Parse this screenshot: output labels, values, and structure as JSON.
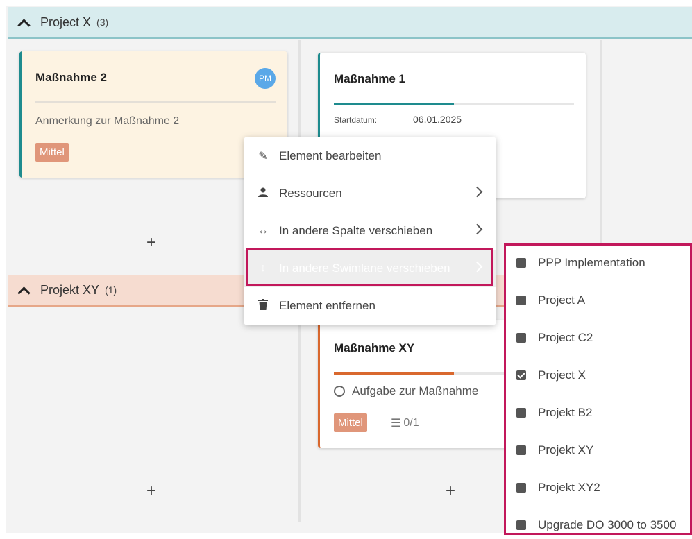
{
  "lanes": {
    "project_x": {
      "title": "Project X",
      "count": "(3)"
    },
    "projekt_xy": {
      "title": "Projekt XY",
      "count": "(1)"
    }
  },
  "cards": {
    "massnahme2": {
      "title": "Maßnahme 2",
      "avatar": "PM",
      "note": "Anmerkung zur Maßnahme 2",
      "priority": "Mittel",
      "accent": "#1e8b8e",
      "background": "#fdf3e2"
    },
    "massnahme1": {
      "title": "Maßnahme 1",
      "progress": 0.5,
      "start_label": "Startdatum:",
      "start_value": "06.01.2025",
      "accent": "#1e8b8e"
    },
    "massnahme_xy": {
      "title": "Maßnahme XY",
      "progress": 0.5,
      "task": "Aufgabe zur Maßnahme",
      "priority": "Mittel",
      "tasks_count": "0/1",
      "accent": "#d9682e"
    }
  },
  "add_button": "+",
  "context_menu": {
    "items": [
      {
        "label": "Element bearbeiten",
        "icon": "pencil-icon"
      },
      {
        "label": "Ressourcen",
        "icon": "person-icon"
      },
      {
        "label": "In andere Spalte verschieben",
        "icon": "horizontal-arrows-icon"
      },
      {
        "label": "In andere Swimlane verschieben",
        "icon": "vertical-arrows-icon"
      },
      {
        "label": "Element entfernen",
        "icon": "trash-icon"
      }
    ]
  },
  "submenu": {
    "items": [
      {
        "label": "PPP Implementation",
        "checked": false
      },
      {
        "label": "Project A",
        "checked": false
      },
      {
        "label": "Project C2",
        "checked": false
      },
      {
        "label": "Project X",
        "checked": true
      },
      {
        "label": "Projekt B2",
        "checked": false
      },
      {
        "label": "Projekt XY",
        "checked": false
      },
      {
        "label": "Projekt XY2",
        "checked": false
      },
      {
        "label": "Upgrade DO 3000 to 3500",
        "checked": false
      }
    ]
  },
  "colors": {
    "highlight": "#c2185b",
    "teal_accent": "#1e8b8e",
    "orange_accent": "#d9682e",
    "priority_badge": "#e0967a",
    "avatar": "#5aa8e8"
  }
}
